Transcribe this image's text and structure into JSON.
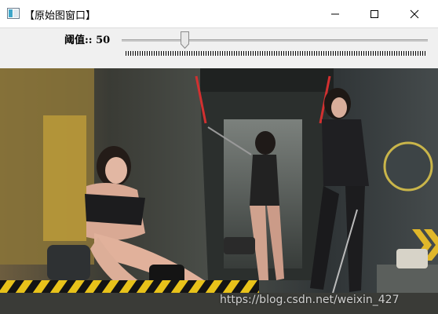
{
  "window": {
    "title": "【原始图窗口】",
    "icon": "window-app-icon",
    "controls": [
      "minimize-icon",
      "maximize-icon",
      "close-icon"
    ]
  },
  "trackbar": {
    "label": "阈值:: 50",
    "value": 50
  },
  "image": {
    "watermark": "https://blog.csdn.net/weixin_427"
  }
}
